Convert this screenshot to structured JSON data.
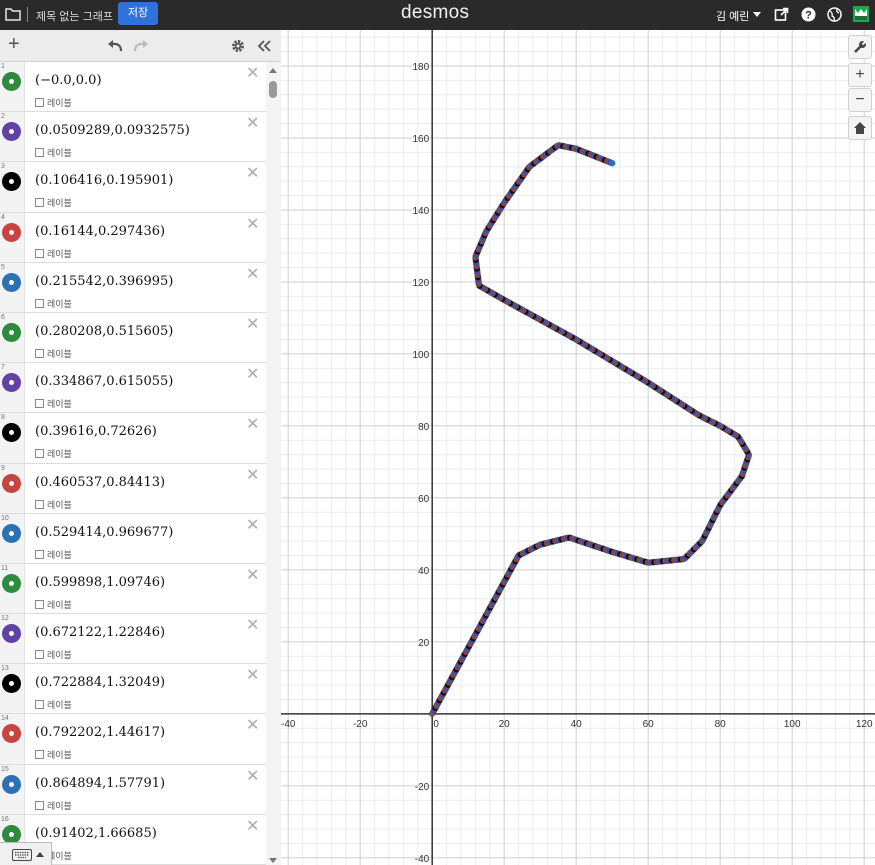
{
  "topbar": {
    "title": "제목 없는 그래프",
    "save_label": "저장",
    "logo": "desmos",
    "user": "김 예린",
    "icons": [
      "folder-icon",
      "share-icon",
      "help-icon",
      "globe-icon",
      "avatar-icon"
    ]
  },
  "toolbar": {
    "add_label": "+",
    "add_icon": "plus-icon",
    "undo_icon": "undo-icon",
    "redo_icon": "redo-icon",
    "settings_icon": "gear-icon",
    "collapse_icon": "double-chevron-left-icon"
  },
  "expressions": [
    {
      "n": "1",
      "text": "(−0.0,0.0)",
      "color": "#2d8a3e",
      "label": "레이블"
    },
    {
      "n": "2",
      "text": "(0.0509289,0.0932575)",
      "color": "#6042a6",
      "label": "레이블"
    },
    {
      "n": "3",
      "text": "(0.106416,0.195901)",
      "color": "#000000",
      "label": "레이블"
    },
    {
      "n": "4",
      "text": "(0.16144,0.297436)",
      "color": "#c74440",
      "label": "레이블"
    },
    {
      "n": "5",
      "text": "(0.215542,0.396995)",
      "color": "#2d70b3",
      "label": "레이블"
    },
    {
      "n": "6",
      "text": "(0.280208,0.515605)",
      "color": "#2d8a3e",
      "label": "레이블"
    },
    {
      "n": "7",
      "text": "(0.334867,0.615055)",
      "color": "#6042a6",
      "label": "레이블"
    },
    {
      "n": "8",
      "text": "(0.39616,0.72626)",
      "color": "#000000",
      "label": "레이블"
    },
    {
      "n": "9",
      "text": "(0.460537,0.84413)",
      "color": "#c74440",
      "label": "레이블"
    },
    {
      "n": "10",
      "text": "(0.529414,0.969677)",
      "color": "#2d70b3",
      "label": "레이블"
    },
    {
      "n": "11",
      "text": "(0.599898,1.09746)",
      "color": "#2d8a3e",
      "label": "레이블"
    },
    {
      "n": "12",
      "text": "(0.672122,1.22846)",
      "color": "#6042a6",
      "label": "레이블"
    },
    {
      "n": "13",
      "text": "(0.722884,1.32049)",
      "color": "#000000",
      "label": "레이블"
    },
    {
      "n": "14",
      "text": "(0.792202,1.44617)",
      "color": "#c74440",
      "label": "레이블"
    },
    {
      "n": "15",
      "text": "(0.864894,1.57791)",
      "color": "#2d70b3",
      "label": "레이블"
    },
    {
      "n": "16",
      "text": "(0.91402,1.66685)",
      "color": "#2d8a3e",
      "label": "레이블"
    }
  ],
  "graph": {
    "x_range": [
      -42,
      123
    ],
    "y_range": [
      -42,
      190
    ],
    "x_ticks": [
      "-40",
      "-20",
      "0",
      "20",
      "40",
      "60",
      "80",
      "100",
      "120"
    ],
    "y_ticks": [
      "-40",
      "-20",
      "20",
      "40",
      "60",
      "80",
      "100",
      "120",
      "140",
      "160",
      "180"
    ],
    "path": [
      [
        0,
        0
      ],
      [
        12,
        22
      ],
      [
        24,
        44
      ],
      [
        30,
        47
      ],
      [
        38,
        49
      ],
      [
        50,
        45
      ],
      [
        60,
        42
      ],
      [
        70,
        43
      ],
      [
        75,
        48
      ],
      [
        80,
        58
      ],
      [
        86,
        66
      ],
      [
        88,
        72
      ],
      [
        85,
        77
      ],
      [
        80,
        80
      ],
      [
        74,
        83
      ],
      [
        60,
        92
      ],
      [
        40,
        104
      ],
      [
        20,
        115
      ],
      [
        13,
        119
      ],
      [
        12,
        127
      ],
      [
        15,
        134
      ],
      [
        20,
        142
      ],
      [
        27,
        152
      ],
      [
        35,
        158
      ],
      [
        40,
        157
      ],
      [
        50,
        153
      ]
    ],
    "point_colors": [
      "#c74440",
      "#2d70b3",
      "#6042a6",
      "#000000"
    ]
  },
  "graph_tools": {
    "wrench_icon": "wrench-icon",
    "zoom_in": "+",
    "zoom_out": "−",
    "home_icon": "home-icon"
  }
}
